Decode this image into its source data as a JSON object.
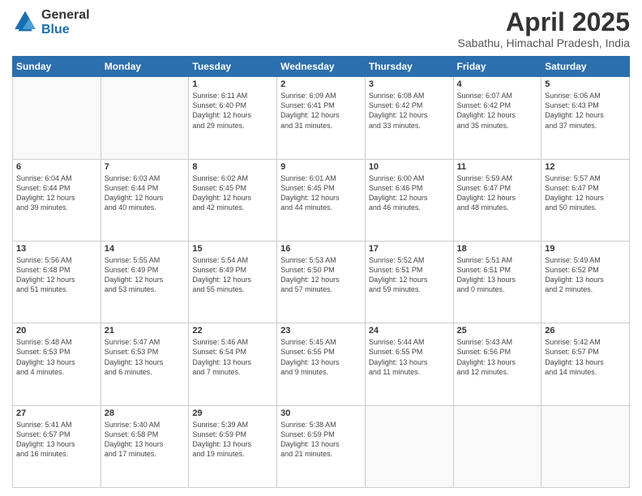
{
  "header": {
    "logo_line1": "General",
    "logo_line2": "Blue",
    "title": "April 2025",
    "subtitle": "Sabathu, Himachal Pradesh, India"
  },
  "days_of_week": [
    "Sunday",
    "Monday",
    "Tuesday",
    "Wednesday",
    "Thursday",
    "Friday",
    "Saturday"
  ],
  "weeks": [
    [
      {
        "day": "",
        "info": ""
      },
      {
        "day": "",
        "info": ""
      },
      {
        "day": "1",
        "info": "Sunrise: 6:11 AM\nSunset: 6:40 PM\nDaylight: 12 hours\nand 29 minutes."
      },
      {
        "day": "2",
        "info": "Sunrise: 6:09 AM\nSunset: 6:41 PM\nDaylight: 12 hours\nand 31 minutes."
      },
      {
        "day": "3",
        "info": "Sunrise: 6:08 AM\nSunset: 6:42 PM\nDaylight: 12 hours\nand 33 minutes."
      },
      {
        "day": "4",
        "info": "Sunrise: 6:07 AM\nSunset: 6:42 PM\nDaylight: 12 hours\nand 35 minutes."
      },
      {
        "day": "5",
        "info": "Sunrise: 6:06 AM\nSunset: 6:43 PM\nDaylight: 12 hours\nand 37 minutes."
      }
    ],
    [
      {
        "day": "6",
        "info": "Sunrise: 6:04 AM\nSunset: 6:44 PM\nDaylight: 12 hours\nand 39 minutes."
      },
      {
        "day": "7",
        "info": "Sunrise: 6:03 AM\nSunset: 6:44 PM\nDaylight: 12 hours\nand 40 minutes."
      },
      {
        "day": "8",
        "info": "Sunrise: 6:02 AM\nSunset: 6:45 PM\nDaylight: 12 hours\nand 42 minutes."
      },
      {
        "day": "9",
        "info": "Sunrise: 6:01 AM\nSunset: 6:45 PM\nDaylight: 12 hours\nand 44 minutes."
      },
      {
        "day": "10",
        "info": "Sunrise: 6:00 AM\nSunset: 6:46 PM\nDaylight: 12 hours\nand 46 minutes."
      },
      {
        "day": "11",
        "info": "Sunrise: 5:59 AM\nSunset: 6:47 PM\nDaylight: 12 hours\nand 48 minutes."
      },
      {
        "day": "12",
        "info": "Sunrise: 5:57 AM\nSunset: 6:47 PM\nDaylight: 12 hours\nand 50 minutes."
      }
    ],
    [
      {
        "day": "13",
        "info": "Sunrise: 5:56 AM\nSunset: 6:48 PM\nDaylight: 12 hours\nand 51 minutes."
      },
      {
        "day": "14",
        "info": "Sunrise: 5:55 AM\nSunset: 6:49 PM\nDaylight: 12 hours\nand 53 minutes."
      },
      {
        "day": "15",
        "info": "Sunrise: 5:54 AM\nSunset: 6:49 PM\nDaylight: 12 hours\nand 55 minutes."
      },
      {
        "day": "16",
        "info": "Sunrise: 5:53 AM\nSunset: 6:50 PM\nDaylight: 12 hours\nand 57 minutes."
      },
      {
        "day": "17",
        "info": "Sunrise: 5:52 AM\nSunset: 6:51 PM\nDaylight: 12 hours\nand 59 minutes."
      },
      {
        "day": "18",
        "info": "Sunrise: 5:51 AM\nSunset: 6:51 PM\nDaylight: 13 hours\nand 0 minutes."
      },
      {
        "day": "19",
        "info": "Sunrise: 5:49 AM\nSunset: 6:52 PM\nDaylight: 13 hours\nand 2 minutes."
      }
    ],
    [
      {
        "day": "20",
        "info": "Sunrise: 5:48 AM\nSunset: 6:53 PM\nDaylight: 13 hours\nand 4 minutes."
      },
      {
        "day": "21",
        "info": "Sunrise: 5:47 AM\nSunset: 6:53 PM\nDaylight: 13 hours\nand 6 minutes."
      },
      {
        "day": "22",
        "info": "Sunrise: 5:46 AM\nSunset: 6:54 PM\nDaylight: 13 hours\nand 7 minutes."
      },
      {
        "day": "23",
        "info": "Sunrise: 5:45 AM\nSunset: 6:55 PM\nDaylight: 13 hours\nand 9 minutes."
      },
      {
        "day": "24",
        "info": "Sunrise: 5:44 AM\nSunset: 6:55 PM\nDaylight: 13 hours\nand 11 minutes."
      },
      {
        "day": "25",
        "info": "Sunrise: 5:43 AM\nSunset: 6:56 PM\nDaylight: 13 hours\nand 12 minutes."
      },
      {
        "day": "26",
        "info": "Sunrise: 5:42 AM\nSunset: 6:57 PM\nDaylight: 13 hours\nand 14 minutes."
      }
    ],
    [
      {
        "day": "27",
        "info": "Sunrise: 5:41 AM\nSunset: 6:57 PM\nDaylight: 13 hours\nand 16 minutes."
      },
      {
        "day": "28",
        "info": "Sunrise: 5:40 AM\nSunset: 6:58 PM\nDaylight: 13 hours\nand 17 minutes."
      },
      {
        "day": "29",
        "info": "Sunrise: 5:39 AM\nSunset: 6:59 PM\nDaylight: 13 hours\nand 19 minutes."
      },
      {
        "day": "30",
        "info": "Sunrise: 5:38 AM\nSunset: 6:59 PM\nDaylight: 13 hours\nand 21 minutes."
      },
      {
        "day": "",
        "info": ""
      },
      {
        "day": "",
        "info": ""
      },
      {
        "day": "",
        "info": ""
      }
    ]
  ]
}
